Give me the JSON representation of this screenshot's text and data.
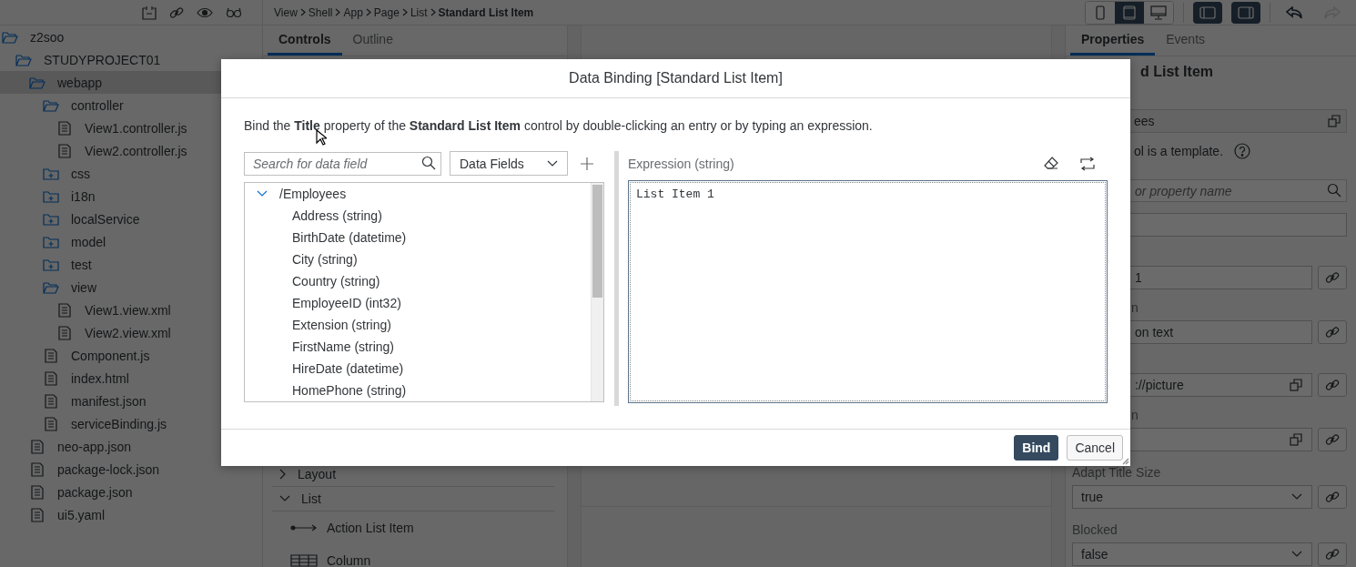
{
  "explorer": {
    "tree": [
      {
        "label": "z2soo",
        "kind": "folder",
        "expanded": true,
        "selected": false,
        "children": [
          {
            "label": "STUDYPROJECT01",
            "kind": "folder",
            "expanded": true,
            "selected": false,
            "children": [
              {
                "label": "webapp",
                "kind": "folder",
                "expanded": true,
                "selected": true,
                "children": [
                  {
                    "label": "controller",
                    "kind": "folder",
                    "expanded": true,
                    "selected": false,
                    "children": [
                      {
                        "label": "View1.controller.js",
                        "kind": "file",
                        "selected": false
                      },
                      {
                        "label": "View2.controller.js",
                        "kind": "file",
                        "selected": false
                      }
                    ]
                  },
                  {
                    "label": "css",
                    "kind": "folder",
                    "expanded": false,
                    "selected": false
                  },
                  {
                    "label": "i18n",
                    "kind": "folder",
                    "expanded": false,
                    "selected": false
                  },
                  {
                    "label": "localService",
                    "kind": "folder",
                    "expanded": false,
                    "selected": false
                  },
                  {
                    "label": "model",
                    "kind": "folder",
                    "expanded": false,
                    "selected": false
                  },
                  {
                    "label": "test",
                    "kind": "folder",
                    "expanded": false,
                    "selected": false
                  },
                  {
                    "label": "view",
                    "kind": "folder",
                    "expanded": true,
                    "selected": false,
                    "children": [
                      {
                        "label": "View1.view.xml",
                        "kind": "file",
                        "selected": false
                      },
                      {
                        "label": "View2.view.xml",
                        "kind": "file",
                        "selected": false
                      }
                    ]
                  },
                  {
                    "label": "Component.js",
                    "kind": "file",
                    "selected": false
                  },
                  {
                    "label": "index.html",
                    "kind": "file",
                    "selected": false
                  },
                  {
                    "label": "manifest.json",
                    "kind": "file",
                    "selected": false
                  },
                  {
                    "label": "serviceBinding.js",
                    "kind": "file",
                    "selected": false
                  }
                ]
              },
              {
                "label": "neo-app.json",
                "kind": "file",
                "selected": false
              },
              {
                "label": "package-lock.json",
                "kind": "file",
                "selected": false
              },
              {
                "label": "package.json",
                "kind": "file",
                "selected": false
              },
              {
                "label": "ui5.yaml",
                "kind": "file",
                "selected": false
              }
            ]
          }
        ]
      }
    ]
  },
  "breadcrumb": [
    {
      "label": "View",
      "current": false
    },
    {
      "label": "Shell",
      "current": false
    },
    {
      "label": "App",
      "current": false
    },
    {
      "label": "Page",
      "current": false
    },
    {
      "label": "List",
      "current": false
    },
    {
      "label": "Standard List Item",
      "current": true
    }
  ],
  "device_toolbar": [
    {
      "kind": "phone",
      "selected": false
    },
    {
      "kind": "tablet",
      "selected": true
    },
    {
      "kind": "desktop",
      "selected": false
    }
  ],
  "pane_toggles": [
    {
      "kind": "left-pane",
      "selected": true
    },
    {
      "kind": "right-pane",
      "selected": true
    }
  ],
  "history": [
    {
      "kind": "undo",
      "disabled": false
    },
    {
      "kind": "redo",
      "disabled": true
    }
  ],
  "palette": {
    "tabs": [
      {
        "label": "Controls",
        "selected": true
      },
      {
        "label": "Outline",
        "selected": false
      }
    ],
    "groups": [
      {
        "label": "Layout",
        "expanded": false
      },
      {
        "label": "List",
        "expanded": true,
        "items": [
          {
            "label": "Action List Item",
            "kind": "action"
          },
          {
            "label": "Column",
            "kind": "column"
          }
        ]
      }
    ]
  },
  "properties": {
    "tabs": [
      {
        "label": "Properties",
        "selected": true
      },
      {
        "label": "Events",
        "selected": false
      }
    ],
    "title": "d List Item",
    "binding": "ees",
    "template_note": "ol is a template.",
    "search_placeholder": "or property name",
    "fields": [
      {
        "kind": "plain"
      },
      {
        "kind": "input",
        "value": "1"
      },
      {
        "kind": "input",
        "label": "n",
        "value": "on text"
      },
      {
        "kind": "input",
        "value": "://picture",
        "value_help": true
      },
      {
        "kind": "input",
        "label": "n",
        "value_help": true
      },
      {
        "kind": "select",
        "label": "Adapt Title Size",
        "value": "true"
      },
      {
        "kind": "select",
        "label": "Blocked",
        "value": "false"
      }
    ]
  },
  "dialog": {
    "title": "Data Binding [Standard List Item]",
    "description": "Bind the **Title** property of the **Standard List Item** control by double-clicking an entry or by typing an expression.",
    "search_placeholder": "Search for data field",
    "filter": "Data Fields",
    "tree": [
      {
        "label": "/Employees",
        "expanded": true,
        "children": [
          {
            "label": "Address (string)"
          },
          {
            "label": "BirthDate (datetime)"
          },
          {
            "label": "City (string)"
          },
          {
            "label": "Country (string)"
          },
          {
            "label": "EmployeeID (int32)"
          },
          {
            "label": "Extension (string)"
          },
          {
            "label": "FirstName (string)"
          },
          {
            "label": "HireDate (datetime)"
          },
          {
            "label": "HomePhone (string)"
          }
        ]
      }
    ],
    "expression_label": "Expression (string)",
    "expression": "List Item 1",
    "buttons": [
      {
        "label": "Bind",
        "kind": "primary"
      },
      {
        "label": "Cancel",
        "kind": "secondary"
      }
    ]
  }
}
